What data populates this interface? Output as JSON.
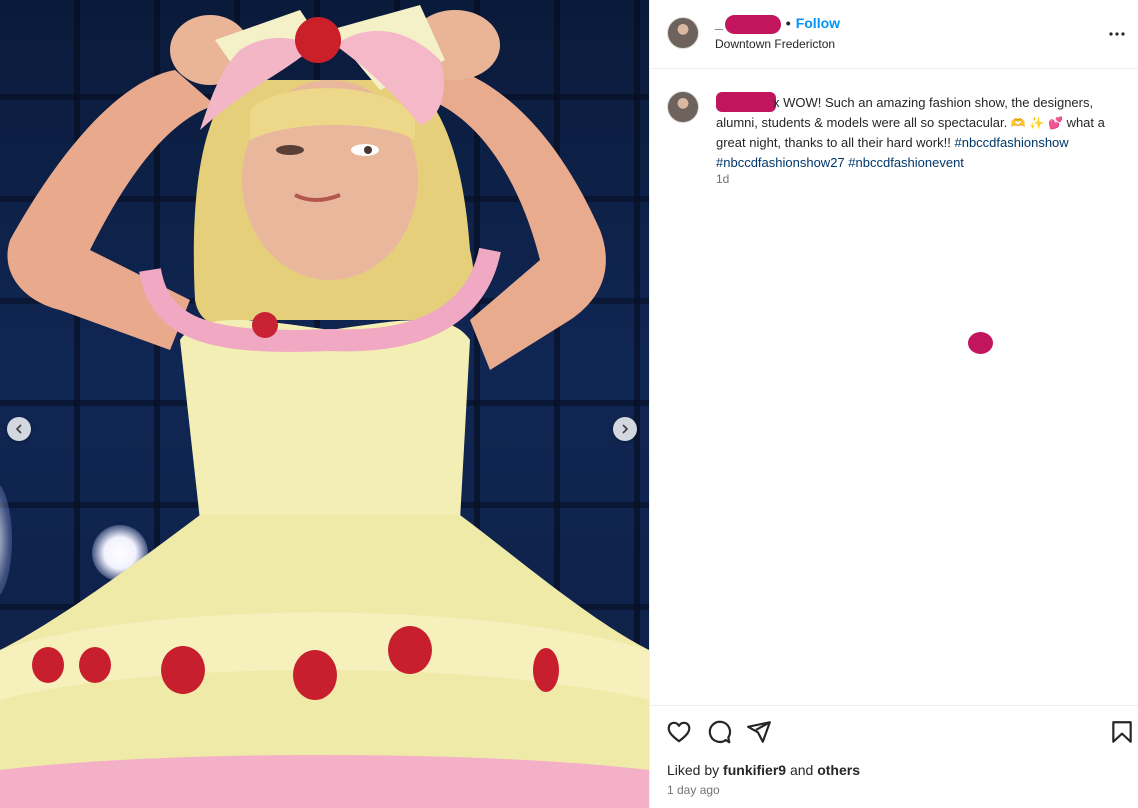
{
  "post": {
    "image_alt_subject": "model in a yellow strawberry dress on stage",
    "nav": {
      "prev_icon": "chevron-left-icon",
      "next_icon": "chevron-right-icon"
    }
  },
  "header": {
    "separator": "•",
    "follow_label": "Follow",
    "location": "Downtown Fredericton",
    "more_icon": "more-horizontal-icon",
    "redaction_color": "#c1155e"
  },
  "caption": {
    "text_part1": "x WOW! Such an amazing fashion show, the designers, alumni, students & models were all so spectacular.",
    "emoji_hands": "🫶",
    "emoji_sparkle": "✨",
    "emoji_hearts": "💕",
    "text_part2": "what a great night, thanks to all their hard work!!",
    "hashtags": [
      "#nbccdfashionshow",
      "#nbccdfashionshow27",
      "#nbccdfashionevent"
    ],
    "time": "1d"
  },
  "actions": {
    "like_icon": "heart-icon",
    "comment_icon": "comment-icon",
    "share_icon": "send-icon",
    "save_icon": "bookmark-icon"
  },
  "likes": {
    "prefix": "Liked by",
    "user": "funkifier9",
    "middle": "and",
    "others": "others"
  },
  "post_time": "1 day ago",
  "colors": {
    "link_blue": "#0095f6",
    "hashtag_blue": "#00376b",
    "muted_text": "#737373",
    "border": "#efefef"
  }
}
